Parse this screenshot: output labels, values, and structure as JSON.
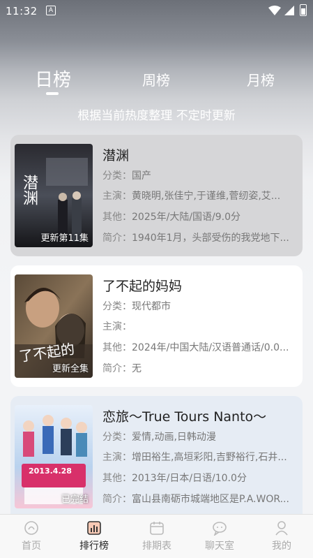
{
  "status_bar": {
    "time": "11:32",
    "notification_glyph": "A"
  },
  "tabs": [
    {
      "label": "日榜",
      "active": true
    },
    {
      "label": "周榜",
      "active": false
    },
    {
      "label": "月榜",
      "active": false
    }
  ],
  "subtitle": "根据当前热度整理 不定时更新",
  "cards": [
    {
      "title": "潜渊",
      "badge": "更新第11集",
      "category_label": "分类：",
      "category": "国产",
      "cast_label": "主演：",
      "cast": "黄晓明,张佳宁,于谨维,菅纫姿,艾...",
      "other_label": "其他：",
      "other": "2025年/大陆/国语/9.0分",
      "intro_label": "简介：",
      "intro": "1940年1月，头部受伤的我党地下...",
      "poster_text": "潜渊",
      "poster_colors": [
        "#2a2a30",
        "#4a4e58",
        "#151518"
      ]
    },
    {
      "title": "了不起的妈妈",
      "badge": "更新全集",
      "category_label": "分类：",
      "category": "现代都市",
      "cast_label": "主演：",
      "cast": "",
      "other_label": "其他：",
      "other": "2024年/中国大陆/汉语普通话/0.0...",
      "intro_label": "简介：",
      "intro": "无",
      "poster_text": "了不起的",
      "poster_colors": [
        "#5a4a38",
        "#8a7358",
        "#2e2620"
      ]
    },
    {
      "title": "恋旅～True Tours Nanto～",
      "badge": "已完结",
      "category_label": "分类：",
      "category": "爱情,动画,日韩动漫",
      "cast_label": "主演：",
      "cast": "增田裕生,高垣彩阳,吉野裕行,石井...",
      "other_label": "其他：",
      "other": "2013年/日本/日语/10.0分",
      "intro_label": "简介：",
      "intro": "富山县南砺市城端地区是P.A.WOR...",
      "poster_text": "2013.4.28",
      "poster_colors": [
        "#e8f0fa",
        "#b9d2ee",
        "#f7c6d6"
      ]
    }
  ],
  "bottom_nav": [
    {
      "label": "首页",
      "icon": "home-icon",
      "active": false
    },
    {
      "label": "排行榜",
      "icon": "ranking-icon",
      "active": true
    },
    {
      "label": "排期表",
      "icon": "calendar-icon",
      "active": false
    },
    {
      "label": "聊天室",
      "icon": "chat-icon",
      "active": false
    },
    {
      "label": "我的",
      "icon": "profile-icon",
      "active": false
    }
  ]
}
